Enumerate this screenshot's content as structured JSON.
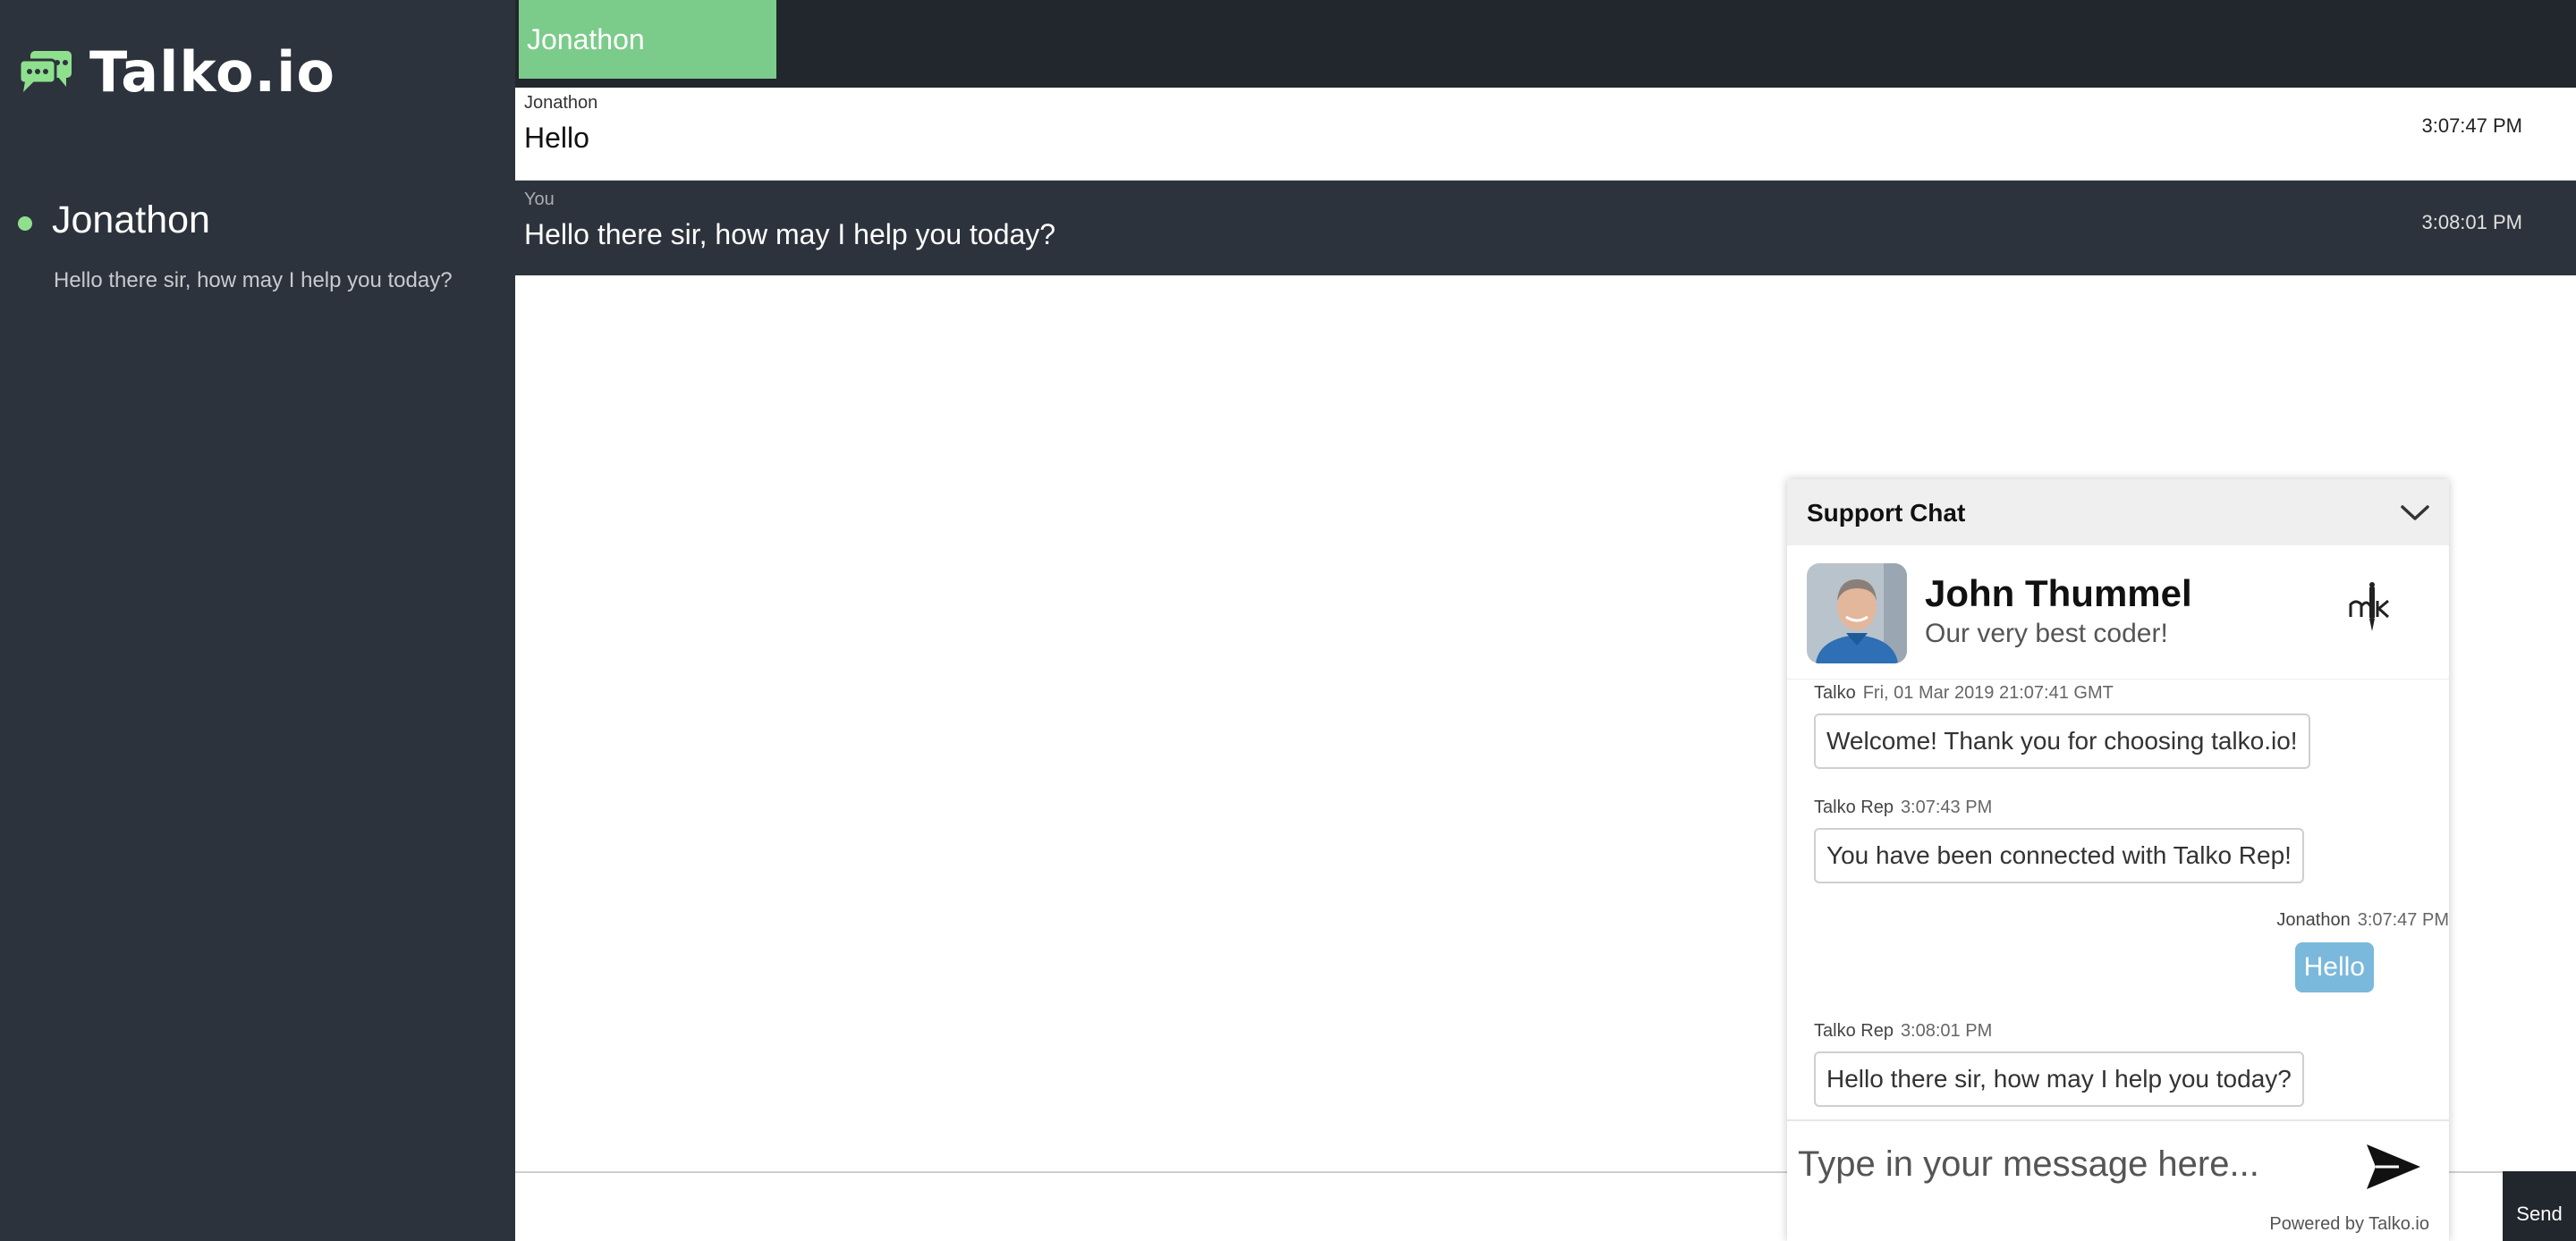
{
  "app": {
    "name": "Talko.io"
  },
  "sidebar": {
    "conversations": [
      {
        "name": "Jonathon",
        "preview": "Hello there sir, how may I help you today?",
        "status": "online"
      }
    ]
  },
  "tabs": [
    {
      "label": "Jonathon",
      "active": true
    }
  ],
  "messages": [
    {
      "sender": "Jonathon",
      "text": "Hello",
      "time": "3:07:47 PM"
    },
    {
      "sender": "You",
      "text": "Hello there sir, how may I help you today?",
      "time": "3:08:01 PM"
    }
  ],
  "composer": {
    "send_label": "Send"
  },
  "widget": {
    "title": "Support Chat",
    "agent": {
      "name": "John Thummel",
      "tagline": "Our very best coder!"
    },
    "messages": [
      {
        "sender": "Talko",
        "time": "Fri, 01 Mar 2019 21:07:41 GMT",
        "text": "Welcome! Thank you for choosing talko.io!",
        "from_me": false
      },
      {
        "sender": "Talko Rep",
        "time": "3:07:43 PM",
        "text": "You have been connected with Talko Rep!",
        "from_me": false
      },
      {
        "sender": "Jonathon",
        "time": "3:07:47 PM",
        "text": "Hello",
        "from_me": true
      },
      {
        "sender": "Talko Rep",
        "time": "3:08:01 PM",
        "text": "Hello there sir, how may I help you today?",
        "from_me": false
      }
    ],
    "input_placeholder": "Type in your message here...",
    "powered_by": "Powered by Talko.io"
  },
  "colors": {
    "sidebar_bg": "#2d333c",
    "topbar_bg": "#22262d",
    "tab_active": "#7bcb8a",
    "online": "#8ee08e",
    "my_bubble": "#7ab8dc"
  },
  "icons": [
    "chat-bubbles-logo-icon",
    "chevron-down-icon",
    "agent-mark-icon",
    "send-arrow-icon"
  ]
}
